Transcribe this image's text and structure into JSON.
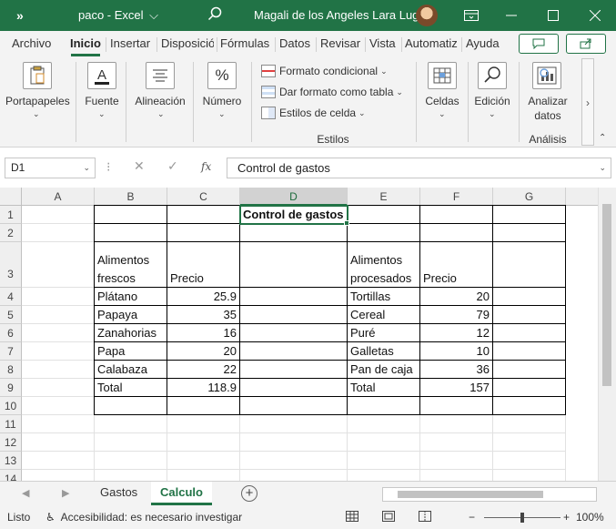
{
  "titlebar": {
    "qat_label": "»",
    "doc_title": "paco  -  Excel",
    "title_chevron": "⌵",
    "user_name": "Magali de los Angeles Lara Lugo",
    "icons": [
      "search-icon",
      "ribbon-display-icon",
      "minimize-icon",
      "maximize-icon",
      "close-icon"
    ]
  },
  "tabs": [
    "Archivo",
    "Inicio",
    "Insertar",
    "Disposició",
    "Fórmulas",
    "Datos",
    "Revisar",
    "Vista",
    "Automatiz",
    "Ayuda"
  ],
  "active_tab": "Inicio",
  "ribbon": {
    "portapapeles": "Portapapeles",
    "fuente": "Fuente",
    "alineacion": "Alineación",
    "numero": "Número",
    "formato_condicional": "Formato condicional",
    "dar_formato": "Dar formato como tabla",
    "estilos_celda": "Estilos de celda",
    "estilos": "Estilos",
    "celdas": "Celdas",
    "edicion": "Edición",
    "analizar_1": "Analizar",
    "analizar_2": "datos",
    "analisis": "Análisis",
    "caret": "⌄",
    "numero_icon_text": "%",
    "scroll_right": "›"
  },
  "formula_bar": {
    "name_box": "D1",
    "dropdown": "⌄",
    "dots": "⁝",
    "cancel": "✕",
    "enter": "✓",
    "fx": "fx",
    "content": "Control de gastos"
  },
  "grid": {
    "columns": [
      "A",
      "B",
      "C",
      "D",
      "E",
      "F",
      "G"
    ],
    "selected_column": "D",
    "rows": [
      "1",
      "2",
      "3",
      "4",
      "5",
      "6",
      "7",
      "8",
      "9",
      "10",
      "11",
      "12",
      "13",
      "14"
    ],
    "title": "Control de gastos",
    "header_fresh": [
      "Alimentos",
      "frescos"
    ],
    "header_price": "Precio",
    "header_processed": [
      "Alimentos",
      "procesados"
    ],
    "fresh": [
      {
        "name": "Plátano",
        "price": "25.9"
      },
      {
        "name": "Papaya",
        "price": "35"
      },
      {
        "name": "Zanahorias",
        "price": "16"
      },
      {
        "name": "Papa",
        "price": "20"
      },
      {
        "name": "Calabaza",
        "price": "22"
      }
    ],
    "fresh_total": {
      "name": "Total",
      "price": "118.9"
    },
    "processed": [
      {
        "name": "Tortillas",
        "price": "20"
      },
      {
        "name": "Cereal",
        "price": "79"
      },
      {
        "name": "Puré",
        "price": "12"
      },
      {
        "name": "Galletas",
        "price": "10"
      },
      {
        "name": "Pan de caja",
        "price": "36"
      }
    ],
    "processed_total": {
      "name": "Total",
      "price": "157"
    }
  },
  "sheets": [
    "Gastos",
    "Calculo"
  ],
  "active_sheet": "Calculo",
  "sheet_nav": [
    "◀",
    "▶"
  ],
  "add_sheet": "+",
  "status": {
    "mode": "Listo",
    "accessibility": "Accesibilidad: es necesario investigar",
    "zoom_minus": "−",
    "zoom_plus": "+",
    "zoom": "100%",
    "zoom_level": 1.0
  },
  "colors": {
    "accent": "#217346"
  }
}
